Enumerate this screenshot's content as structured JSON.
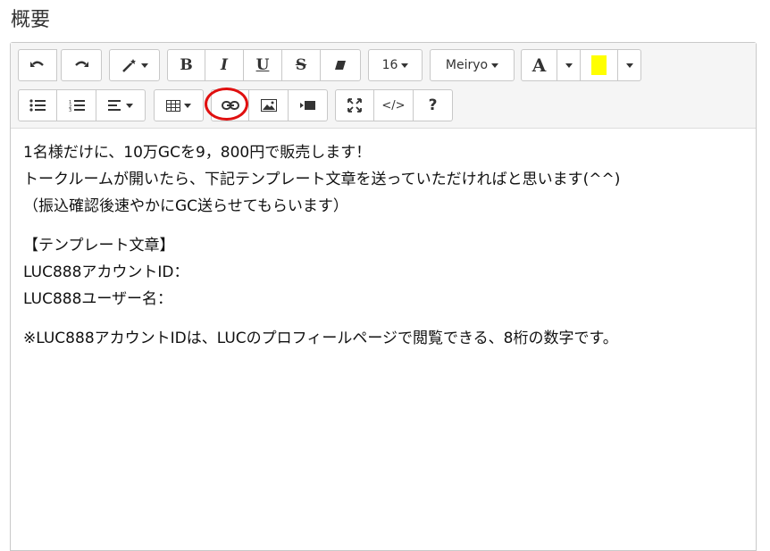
{
  "page": {
    "heading": "概要"
  },
  "toolbar": {
    "font_size": "16",
    "font_name": "Meiryo",
    "font_color_label": "A",
    "highlight_color": "#ffff00",
    "bold_label": "B",
    "italic_label": "I",
    "underline_label": "U",
    "strike_label": "S",
    "code_label": "</>",
    "help_label": "?",
    "icons": [
      "undo-icon",
      "redo-icon",
      "magic-wand-icon",
      "eraser-icon",
      "unordered-list-icon",
      "ordered-list-icon",
      "align-icon",
      "table-icon",
      "link-icon",
      "picture-icon",
      "video-icon",
      "fullscreen-icon"
    ]
  },
  "annotation": {
    "color": "#e01010",
    "target": "link-button"
  },
  "content": {
    "lines": [
      "1名様だけに、10万GCを9，800円で販売します！",
      "トークルームが開いたら、下記テンプレート文章を送っていただければと思います(^^)",
      "（振込確認後速やかにGC送らせてもらいます）",
      "【テンプレート文章】",
      "LUC888アカウントID：",
      "LUC888ユーザー名：",
      "※LUC888アカウントIDは、LUCのプロフィールページで閲覧できる、8桁の数字です。"
    ]
  }
}
